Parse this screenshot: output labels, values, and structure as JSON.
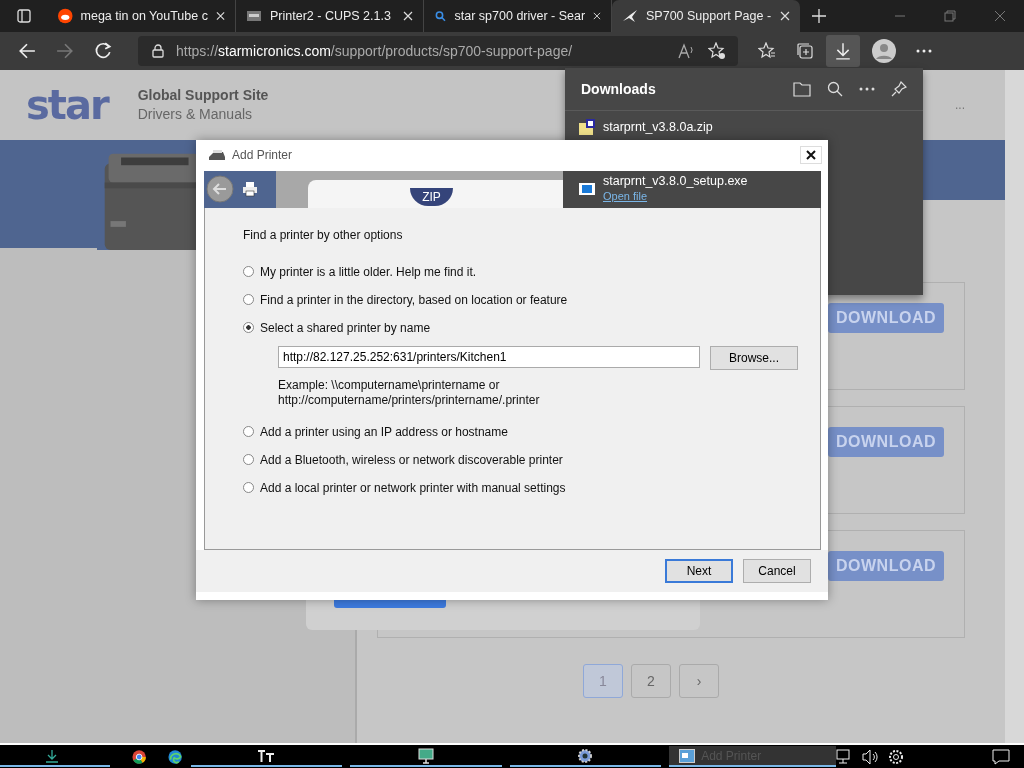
{
  "browser": {
    "tabs": [
      {
        "title": "mega tin on YouTube c",
        "selected": false
      },
      {
        "title": "Printer2 - CUPS 2.1.3",
        "selected": false
      },
      {
        "title": "star sp700 driver - Sear",
        "selected": false
      },
      {
        "title": "SP700 Support Page - ",
        "selected": true
      }
    ],
    "url": {
      "scheme": "https://",
      "host": "starmicronics.com",
      "path": "/support/products/sp700-support-page/"
    }
  },
  "site": {
    "logo": "star",
    "title": "Global Support Site",
    "subtitle": "Drivers & Manuals",
    "more": "...",
    "downloads": [
      {
        "label": "DOWNLOAD"
      },
      {
        "label": "DOWNLOAD"
      },
      {
        "label": "DOWNLOAD"
      }
    ],
    "pages": [
      {
        "label": "1",
        "selected": true
      },
      {
        "label": "2",
        "selected": false
      },
      {
        "label": "›",
        "selected": false
      }
    ]
  },
  "downloads_panel": {
    "title": "Downloads",
    "items": [
      {
        "name": "starprnt_v3.8.0a.zip",
        "kind": "zip"
      }
    ]
  },
  "dialog": {
    "title": "Add Printer",
    "header_item": {
      "name": "starprnt_v3.8.0_setup.exe",
      "action": "Open file"
    },
    "zip_badge": "ZIP",
    "heading": "Find a printer by other options",
    "options": [
      {
        "label": "My printer is a little older. Help me find it.",
        "selected": false
      },
      {
        "label": "Find a printer in the directory, based on location or feature",
        "selected": false
      },
      {
        "label": "Select a shared printer by name",
        "selected": true,
        "field": {
          "value": "http://82.127.25.252:631/printers/Kitchen1",
          "button": "Browse...",
          "example": "Example: \\\\computername\\printername or\nhttp://computername/printers/printername/.printer"
        }
      },
      {
        "label": "Add a printer using an IP address or hostname",
        "selected": false
      },
      {
        "label": "Add a Bluetooth, wireless or network discoverable printer",
        "selected": false
      },
      {
        "label": "Add a local printer or network printer with manual settings",
        "selected": false
      }
    ],
    "buttons": [
      "Next",
      "Cancel"
    ]
  },
  "taskbar": {
    "items": [
      {
        "kind": "download"
      },
      {
        "kind": "chrome"
      },
      {
        "kind": "edge"
      },
      {
        "kind": "font"
      },
      {
        "kind": "monitor"
      },
      {
        "kind": "gear"
      },
      {
        "kind": "window",
        "label": "Add Printer"
      }
    ]
  }
}
